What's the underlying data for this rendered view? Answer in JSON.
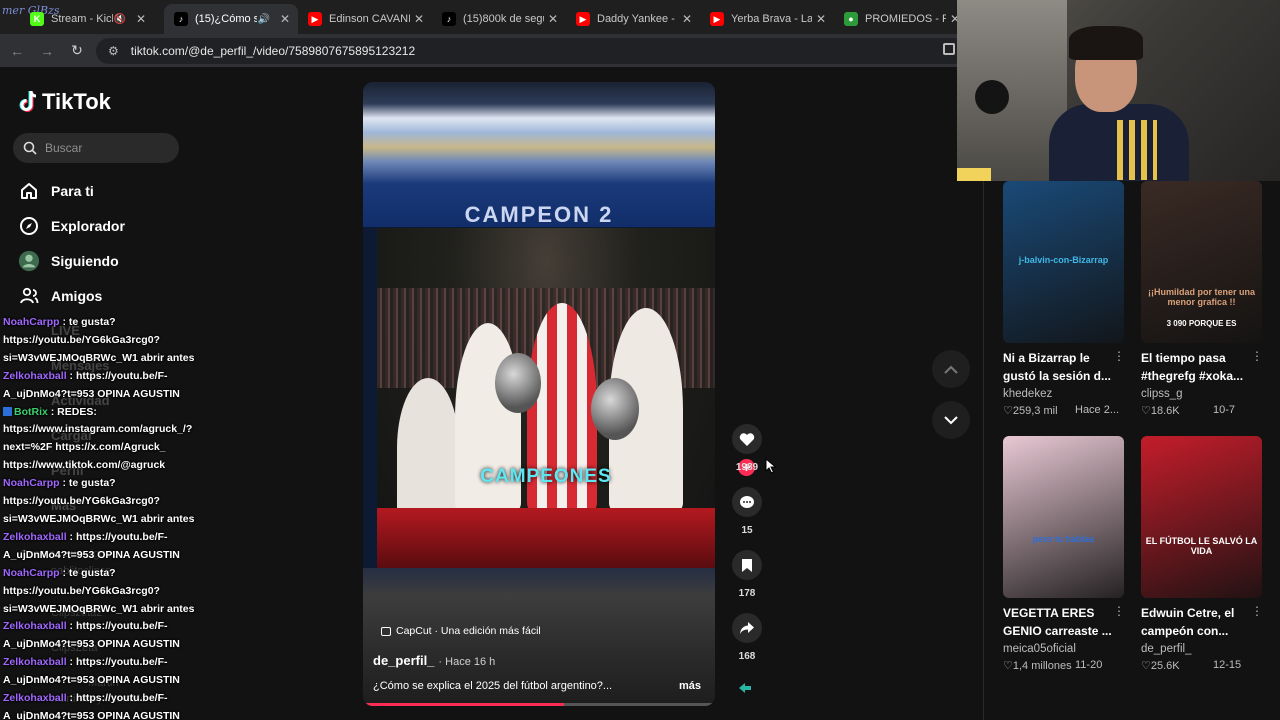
{
  "browser": {
    "corner_logo": "mer GlBzs",
    "tabs": [
      {
        "title": "Stream - Kick",
        "favicon_color": "#53fc18",
        "favicon_text": "K",
        "active": false,
        "muted": true
      },
      {
        "title": "(15)¿Cómo se",
        "favicon_color": "#000000",
        "favicon_text": "♪",
        "active": true,
        "muted": false,
        "audio": true
      },
      {
        "title": "Edinson CAVANI",
        "favicon_color": "#ff0000",
        "favicon_text": "▶",
        "active": false
      },
      {
        "title": "(15)800k de segu",
        "favicon_color": "#000000",
        "favicon_text": "♪",
        "active": false
      },
      {
        "title": "Daddy Yankee - La",
        "favicon_color": "#ff0000",
        "favicon_text": "▶",
        "active": false
      },
      {
        "title": "Yerba Brava - La C",
        "favicon_color": "#ff0000",
        "favicon_text": "▶",
        "active": false
      },
      {
        "title": "PROMIEDOS - Fu",
        "favicon_color": "#2e9b3b",
        "favicon_text": "●",
        "active": false
      }
    ],
    "url": "tiktok.com/@de_perfil_/video/7589807675895123212"
  },
  "sidebar": {
    "logo": "TikTok",
    "search_placeholder": "Buscar",
    "nav": [
      {
        "label": "Para ti",
        "icon": "home-icon"
      },
      {
        "label": "Explorador",
        "icon": "compass-icon"
      },
      {
        "label": "Siguiendo",
        "icon": "following-avatar-icon"
      },
      {
        "label": "Amigos",
        "icon": "friends-icon"
      }
    ],
    "ghost_items": [
      "LIVE",
      "Mensajes",
      "Actividad",
      "Cargar",
      "Perfil",
      "Más",
      "Cuentas que sigues",
      "pablitoclipss",
      "Clipszeta2",
      "ClipsZeta",
      "Martin",
      "martinfooyxtzemble"
    ]
  },
  "chat": [
    {
      "user": "NoahCarpp",
      "color": "purple",
      "text": ": te gusta? https://youtu.be/YG6kGa3rcg0?si=W3vWEJMOqBRWc_W1 abrir antes"
    },
    {
      "user": "Zelkohaxball",
      "color": "purple",
      "text": ": https://youtu.be/F-A_ujDnMo4?t=953 OPINA AGUSTIN"
    },
    {
      "user": "BotRix",
      "color": "green",
      "text": ": REDES: https://www.instagram.com/agruck_/?next=%2F https://x.com/Agruck_ https://www.tiktok.com/@agruck"
    },
    {
      "user": "NoahCarpp",
      "color": "purple",
      "text": ": te gusta? https://youtu.be/YG6kGa3rcg0?si=W3vWEJMOqBRWc_W1 abrir antes"
    },
    {
      "user": "Zelkohaxball",
      "color": "purple",
      "text": ": https://youtu.be/F-A_ujDnMo4?t=953 OPINA AGUSTIN"
    },
    {
      "user": "NoahCarpp",
      "color": "purple",
      "text": ": te gusta? https://youtu.be/YG6kGa3rcg0?si=W3vWEJMOqBRWc_W1 abrir antes"
    },
    {
      "user": "Zelkohaxball",
      "color": "purple",
      "text": ": https://youtu.be/F-A_ujDnMo4?t=953 OPINA AGUSTIN"
    },
    {
      "user": "Zelkohaxball",
      "color": "purple",
      "text": ": https://youtu.be/F-A_ujDnMo4?t=953 OPINA AGUSTIN"
    },
    {
      "user": "Zelkohaxball",
      "color": "purple",
      "text": ": https://youtu.be/F-A_ujDnMo4?t=953 OPINA AGUSTIN"
    }
  ],
  "chat_lines": [
    [
      {
        "u": "NoahCarpp",
        "c": "purple"
      },
      {
        "t": " : te gusta?"
      }
    ],
    [
      {
        "t": "https://youtu.be/YG6kGa3rcg0?"
      }
    ],
    [
      {
        "t": "si=W3vWEJMOqBRWc_W1 abrir antes"
      }
    ],
    [
      {
        "u": "Zelkohaxball",
        "c": "purple"
      },
      {
        "t": " : https://youtu.be/F-"
      }
    ],
    [
      {
        "t": "A_ujDnMo4?t=953 OPINA AGUSTIN"
      }
    ],
    [
      {
        "badge": true
      },
      {
        "u": "BotRix",
        "c": "green"
      },
      {
        "t": " : REDES:"
      }
    ],
    [
      {
        "t": "https://www.instagram.com/agruck_/?"
      }
    ],
    [
      {
        "t": "next=%2F https://x.com/Agruck_"
      }
    ],
    [
      {
        "t": "https://www.tiktok.com/@agruck"
      }
    ],
    [
      {
        "u": "NoahCarpp",
        "c": "purple"
      },
      {
        "t": " : te gusta?"
      }
    ],
    [
      {
        "t": "https://youtu.be/YG6kGa3rcg0?"
      }
    ],
    [
      {
        "t": "si=W3vWEJMOqBRWc_W1 abrir antes"
      }
    ],
    [
      {
        "u": "Zelkohaxball",
        "c": "purple"
      },
      {
        "t": " : https://youtu.be/F-"
      }
    ],
    [
      {
        "t": "A_ujDnMo4?t=953 OPINA AGUSTIN"
      }
    ],
    [
      {
        "u": "NoahCarpp",
        "c": "purple"
      },
      {
        "t": " : te gusta?"
      }
    ],
    [
      {
        "t": "https://youtu.be/YG6kGa3rcg0?"
      }
    ],
    [
      {
        "t": "si=W3vWEJMOqBRWc_W1 abrir antes"
      }
    ],
    [
      {
        "u": "Zelkohaxball",
        "c": "purple"
      },
      {
        "t": " : https://youtu.be/F-"
      }
    ],
    [
      {
        "t": "A_ujDnMo4?t=953 OPINA AGUSTIN"
      }
    ],
    [
      {
        "u": "Zelkohaxball",
        "c": "purple"
      },
      {
        "t": " : https://youtu.be/F-"
      }
    ],
    [
      {
        "t": "A_ujDnMo4?t=953 OPINA AGUSTIN"
      }
    ],
    [
      {
        "u": "Zelkohaxball",
        "c": "purple"
      },
      {
        "t": " : https://youtu.be/F-"
      }
    ],
    [
      {
        "t": "A_ujDnMo4?t=953 OPINA AGUSTIN"
      }
    ]
  ],
  "video": {
    "banner_text": "CAMPEON 2",
    "overlay_text": "CAMPEONES",
    "capcut_label": "CapCut · Una edición más fácil",
    "author": "de_perfil_",
    "time": "· Hace 16 h",
    "caption": "¿Cómo se explica el 2025 del fútbol argentino?...",
    "more": "más",
    "progress": 0.57
  },
  "actions": {
    "likes": "1989",
    "comments": "15",
    "saves": "178",
    "shares": "168"
  },
  "recommended": [
    {
      "title": "Ni a Bizarrap le gustó la sesión d...",
      "author": "khedekez",
      "likes": "259,3 mil",
      "date": "Hace 2...",
      "thumb_text": "j-balvin-con-Bizarrap",
      "bg": "#1a4a78",
      "accent": "#3fb8e8"
    },
    {
      "title": "El tiempo pasa #thegrefg #xoka...",
      "author": "clipss_g",
      "likes": "18.6K",
      "date": "10-7",
      "thumb_text": "¡¡Humildad por tener una menor grafica !!",
      "thumb_text2": "3 090 PORQUE ES",
      "bg": "#3a2a24",
      "accent": "#d9a07a"
    },
    {
      "title": "VEGETTA ERES GENIO carreaste ...",
      "author": "meica05oficial",
      "likes": "1,4 millones",
      "date": "11-20",
      "thumb_text": "pero tu hablas",
      "bg": "#e8c8d4",
      "accent": "#2e6fd8"
    },
    {
      "title": "Edwuin Cetre, el campeón con...",
      "author": "de_perfil_",
      "likes": "25.6K",
      "date": "12-15",
      "thumb_text": "EL FÚTBOL LE SALVÓ LA VIDA",
      "bg": "#c41d2a",
      "accent": "#ffffff"
    }
  ]
}
